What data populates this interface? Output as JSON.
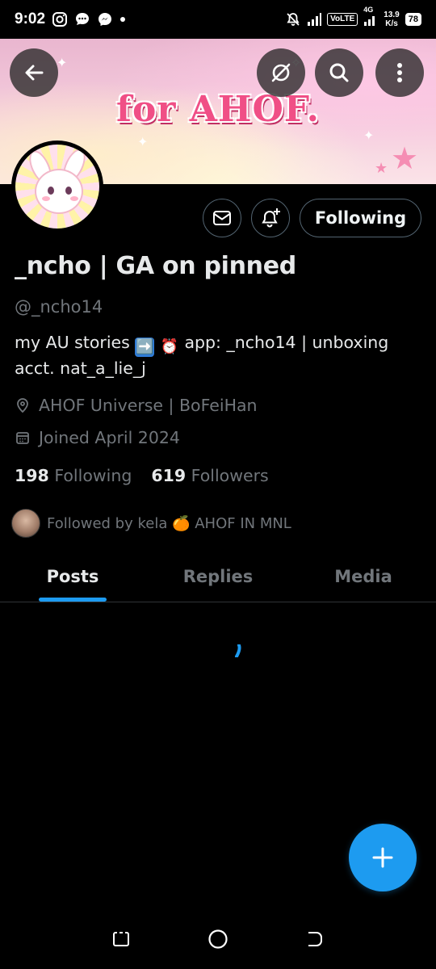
{
  "status_bar": {
    "time": "9:02",
    "volte": "VoLTE",
    "net_type": "4G",
    "net_speed_value": "13.9",
    "net_speed_unit": "K/s",
    "battery": "78"
  },
  "banner": {
    "title": "for AHOF."
  },
  "profile": {
    "display_name": "_ncho | GA on pinned",
    "handle": "@_ncho14",
    "bio_part1": "my AU stories",
    "bio_emoji1": "➡️",
    "bio_emoji2": "⏰",
    "bio_part2": "app:  _ncho14 | unboxing acct. nat_a_lie_j",
    "location": "AHOF Universe | BoFeiHan",
    "joined": "Joined April 2024",
    "following_count": "198",
    "following_label": "Following",
    "followers_count": "619",
    "followers_label": "Followers",
    "followed_by": "Followed by kela 🍊 AHOF IN MNL",
    "follow_button_label": "Following"
  },
  "tabs": [
    {
      "label": "Posts",
      "active": true
    },
    {
      "label": "Replies",
      "active": false
    },
    {
      "label": "Media",
      "active": false
    }
  ],
  "colors": {
    "accent": "#1d9bf0",
    "banner_text": "#f04f86",
    "muted": "#71767b"
  }
}
